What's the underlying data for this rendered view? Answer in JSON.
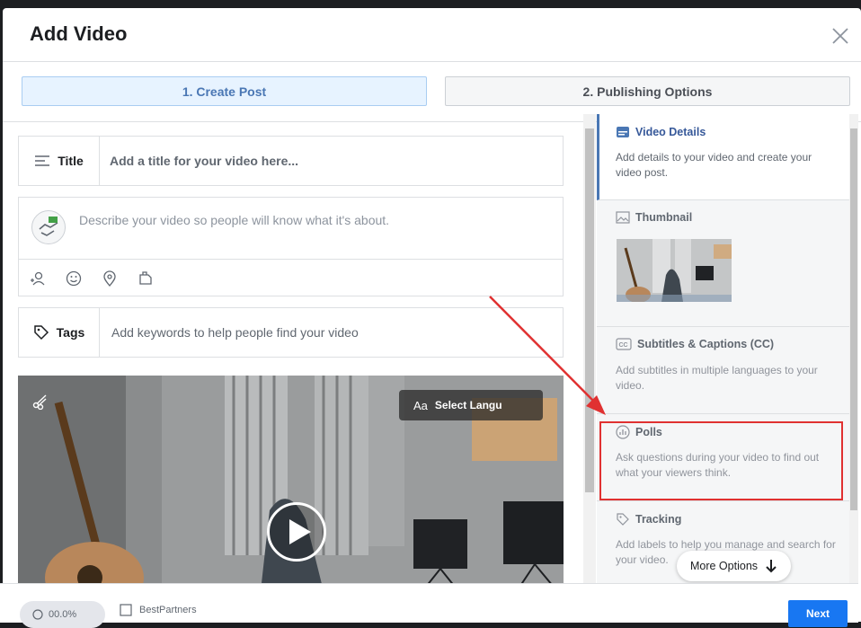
{
  "dialog": {
    "title": "Add Video"
  },
  "steps": [
    {
      "label": "1. Create Post",
      "active": true
    },
    {
      "label": "2. Publishing Options",
      "active": false
    }
  ],
  "form": {
    "title_label": "Title",
    "title_placeholder": "Add a title for your video here...",
    "description_placeholder": "Describe your video so people will know what it's about.",
    "tags_label": "Tags",
    "tags_placeholder": "Add keywords to help people find your video"
  },
  "video": {
    "language_label": "Select Langu"
  },
  "sidebar": {
    "sections": [
      {
        "title": "Video Details",
        "desc": "Add details to your video and create your video post.",
        "icon": "video-details-icon"
      },
      {
        "title": "Thumbnail",
        "icon": "image-icon"
      },
      {
        "title": "Subtitles & Captions (CC)",
        "desc": "Add subtitles in multiple languages to your video.",
        "icon": "cc-icon"
      },
      {
        "title": "Polls",
        "desc": "Ask questions during your video to find out what your viewers think.",
        "icon": "poll-icon"
      },
      {
        "title": "Tracking",
        "desc": "Add labels to help you manage and search for your video.",
        "icon": "tag-icon"
      }
    ],
    "more_options": "More Options"
  },
  "footer": {
    "pill_text": "00.0%",
    "partner_text": "BestPartners",
    "next_label": "Next"
  },
  "colors": {
    "accent": "#4a77b4",
    "highlight": "#e03131",
    "primary_button": "#1877f2"
  }
}
